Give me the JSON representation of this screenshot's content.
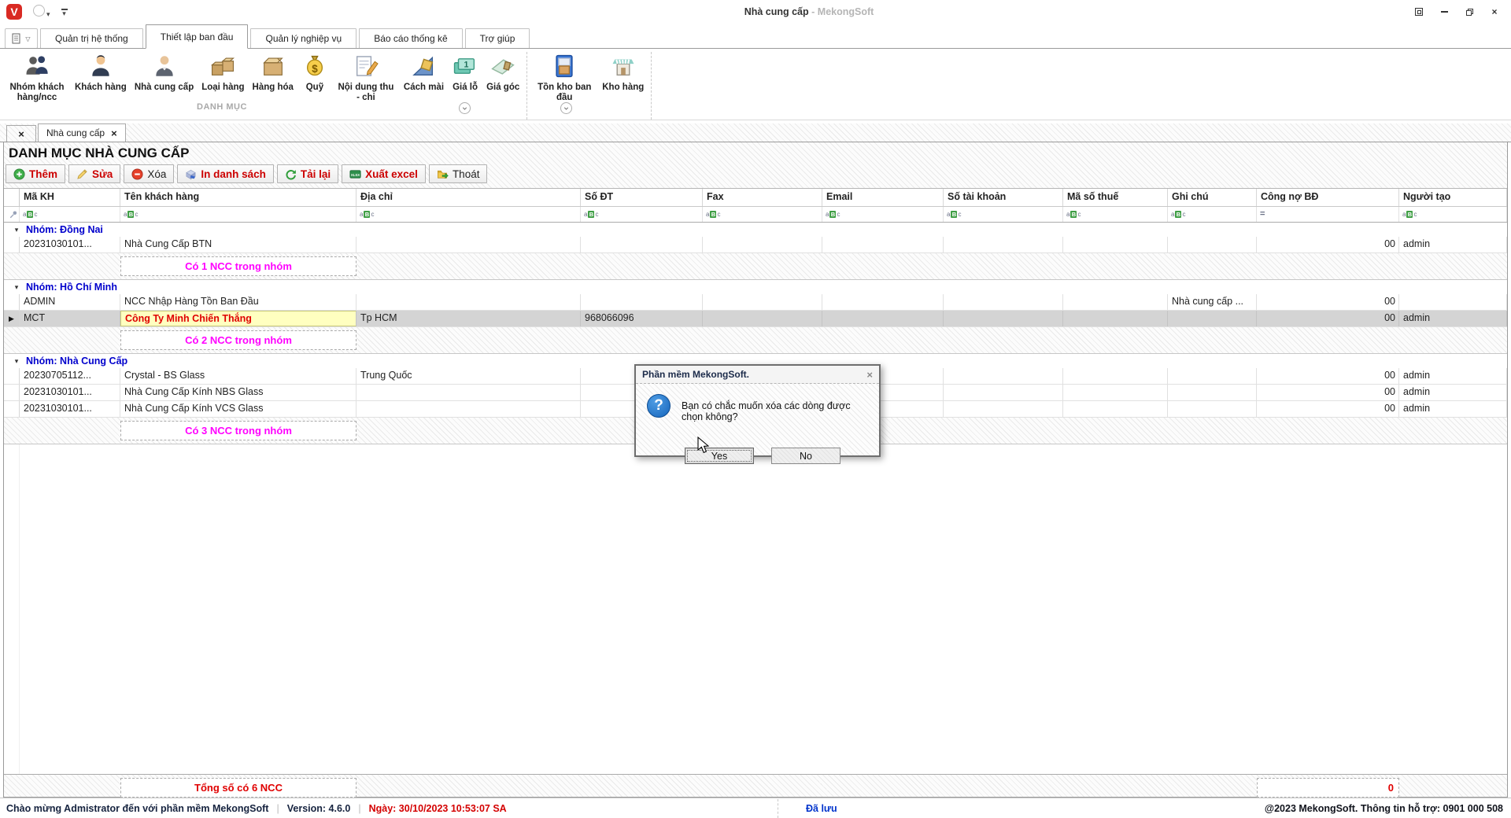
{
  "window": {
    "title_doc": "Nhà cung cấp",
    "title_app": "- MekongSoft"
  },
  "ribbon": {
    "active_tab": "Thiết lập ban đầu",
    "tabs": [
      {
        "label": "Quản trị hệ thống"
      },
      {
        "label": "Thiết lập ban đầu"
      },
      {
        "label": "Quản lý nghiệp vụ"
      },
      {
        "label": "Báo cáo thống kê"
      },
      {
        "label": "Trợ giúp"
      }
    ],
    "group_caption": "DANH MỤC",
    "items": [
      {
        "id": "nhom-khach-hang-ncc",
        "label": "Nhóm khách hàng/ncc",
        "icon": "people"
      },
      {
        "id": "khach-hang",
        "label": "Khách hàng",
        "icon": "person"
      },
      {
        "id": "nha-cung-cap",
        "label": "Nhà cung cấp",
        "icon": "supplier"
      },
      {
        "id": "loai-hang",
        "label": "Loại hàng",
        "icon": "boxes"
      },
      {
        "id": "hang-hoa",
        "label": "Hàng hóa",
        "icon": "box"
      },
      {
        "id": "quy",
        "label": "Quỹ",
        "icon": "money-bag"
      },
      {
        "id": "noi-dung-thu-chi",
        "label": "Nội dung thu - chi",
        "icon": "note-pencil"
      },
      {
        "id": "cach-mai",
        "label": "Cách mài",
        "icon": "ruler-money"
      },
      {
        "id": "gia-lo",
        "label": "Giá lỗ",
        "icon": "price-cards"
      },
      {
        "id": "gia-goc",
        "label": "Giá góc",
        "icon": "glass-corner",
        "divider_after": true
      },
      {
        "id": "ton-kho-ban-dau",
        "label": "Tồn kho ban đầu",
        "icon": "cabinet"
      },
      {
        "id": "kho-hang",
        "label": "Kho hàng",
        "icon": "store",
        "divider_after": true
      }
    ]
  },
  "doc_tab": {
    "label": "Nhà cung cấp"
  },
  "page": {
    "heading": "DANH MỤC NHÀ CUNG CẤP"
  },
  "toolbar": {
    "buttons": [
      {
        "id": "them",
        "label": "Thêm",
        "icon": "add",
        "text_color": "#cc0000",
        "bold": true
      },
      {
        "id": "sua",
        "label": "Sửa",
        "icon": "edit",
        "text_color": "#cc0000",
        "bold": true
      },
      {
        "id": "xoa",
        "label": "Xóa",
        "icon": "delete",
        "text_color": "#222222",
        "bold": false
      },
      {
        "id": "in-danh-sach",
        "label": "In danh sách",
        "icon": "print-list",
        "text_color": "#cc0000",
        "bold": true
      },
      {
        "id": "tai-lai",
        "label": "Tải lại",
        "icon": "reload",
        "text_color": "#cc0000",
        "bold": true
      },
      {
        "id": "xuat-excel",
        "label": "Xuất excel",
        "icon": "excel",
        "text_color": "#cc0000",
        "bold": true
      },
      {
        "id": "thoat",
        "label": "Thoát",
        "icon": "exit",
        "text_color": "#222222",
        "bold": false
      }
    ]
  },
  "grid": {
    "columns": [
      {
        "key": "ma_kh",
        "label": "Mã KH",
        "filter": "abc"
      },
      {
        "key": "ten",
        "label": "Tên khách hàng",
        "filter": "abc"
      },
      {
        "key": "dia_chi",
        "label": "Địa chỉ",
        "filter": "abc"
      },
      {
        "key": "so_dt",
        "label": "Số ĐT",
        "filter": "abc"
      },
      {
        "key": "fax",
        "label": "Fax",
        "filter": "abc"
      },
      {
        "key": "email",
        "label": "Email",
        "filter": "abc"
      },
      {
        "key": "so_tk",
        "label": "Số tài khoản",
        "filter": "abc"
      },
      {
        "key": "ma_so_thue",
        "label": "Mã số thuế",
        "filter": "abc"
      },
      {
        "key": "ghi_chu",
        "label": "Ghi chú",
        "filter": "abc"
      },
      {
        "key": "cong_no",
        "label": "Công nợ BĐ",
        "filter": "eq",
        "align": "right"
      },
      {
        "key": "nguoi_tao",
        "label": "Người tạo",
        "filter": "abc"
      }
    ],
    "groups": [
      {
        "label": "Nhóm: Đồng Nai",
        "rows": [
          {
            "cells": {
              "ma_kh": "20231030101...",
              "ten": "Nhà Cung Cấp BTN",
              "cong_no": "00",
              "nguoi_tao": "admin"
            }
          }
        ],
        "footer": "Có 1 NCC trong nhóm"
      },
      {
        "label": "Nhóm: Hồ Chí Minh",
        "rows": [
          {
            "cells": {
              "ma_kh": "ADMIN",
              "ten": "NCC Nhập Hàng Tồn Ban Đầu",
              "ghi_chu": "Nhà cung cấp ...",
              "cong_no": "00"
            }
          },
          {
            "cells": {
              "ma_kh": "MCT",
              "ten": "Công Ty Minh Chiến Thắng",
              "dia_chi": "Tp HCM",
              "so_dt": "968066096",
              "cong_no": "00",
              "nguoi_tao": "admin"
            },
            "selected": true,
            "name_highlight": true
          }
        ],
        "footer": "Có 2 NCC trong nhóm"
      },
      {
        "label": "Nhóm: Nhà Cung Cấp",
        "rows": [
          {
            "cells": {
              "ma_kh": "20230705112...",
              "ten": "Crystal - BS Glass",
              "dia_chi": "Trung Quốc",
              "cong_no": "00",
              "nguoi_tao": "admin"
            }
          },
          {
            "cells": {
              "ma_kh": "20231030101...",
              "ten": "Nhà Cung Cấp Kính NBS Glass",
              "cong_no": "00",
              "nguoi_tao": "admin"
            }
          },
          {
            "cells": {
              "ma_kh": "20231030101...",
              "ten": "Nhà Cung Cấp Kính VCS Glass",
              "cong_no": "00",
              "nguoi_tao": "admin"
            }
          }
        ],
        "footer": "Có 3 NCC trong nhóm"
      }
    ],
    "total": {
      "label": "Tổng số có 6 NCC",
      "value": "0"
    }
  },
  "dialog": {
    "title": "Phần mềm MekongSoft.",
    "message": "Bạn có chắc muốn xóa các dòng được chọn không?",
    "yes_label": "Yes",
    "no_label": "No"
  },
  "statusbar": {
    "welcome": "Chào mừng Admistrator đến với phần mềm MekongSoft",
    "version": "Version: 4.6.0",
    "date": "Ngày: 30/10/2023 10:53:07 SA",
    "saved": "Đã lưu",
    "copyright": "@2023 MekongSoft. Thông tin hỗ trợ: 0901 000 508"
  },
  "colors": {
    "accent_red": "#cc0000",
    "group_blue": "#0000cc",
    "footer_magenta": "#ff00ff",
    "highlight_yellow": "#ffffc0",
    "saved_blue": "#0033cc",
    "logo_red": "#d92a23"
  }
}
